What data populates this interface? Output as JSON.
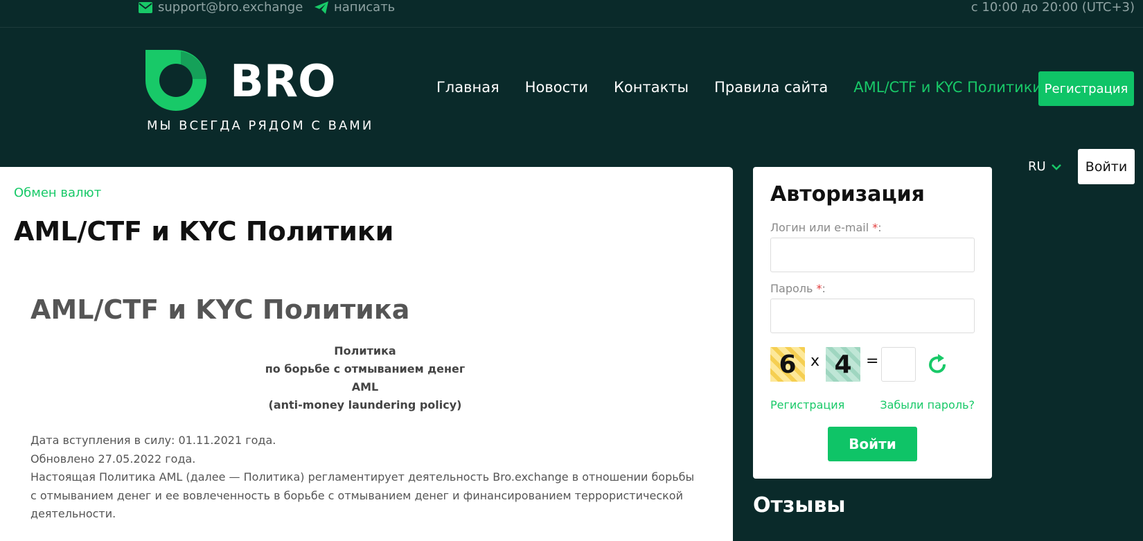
{
  "topbar": {
    "email": "support@bro.exchange",
    "telegram": "написать",
    "hours": "с 10:00 до 20:00 (UTC+3)"
  },
  "logo": {
    "name": "BRO",
    "slogan": "МЫ ВСЕГДА РЯДОМ С ВАМИ"
  },
  "nav": [
    "Главная",
    "Новости",
    "Контакты",
    "Правила сайта",
    "AML/CTF и KYC Политики"
  ],
  "header": {
    "register": "Регистрация",
    "lang": "RU",
    "login": "Войти"
  },
  "content": {
    "breadcrumb": "Обмен валют",
    "title": "AML/CTF и KYC Политики",
    "subtitle": "AML/CTF и KYC Политика",
    "center_lines": [
      "Политика",
      "по борьбе с отмыванием денег",
      "AML",
      "(anti-money laundering policy)"
    ],
    "para": [
      "Дата вступления в силу: 01.11.2021 года.",
      "Обновлено 27.05.2022 года.",
      "Настоящая Политика AML (далее — Политика) регламентирует деятельность Bro.exchange в отношении борьбы с отмыванием денег и ее вовлеченность в борьбе с отмыванием денег и финансированием террористической деятельности."
    ]
  },
  "auth": {
    "title": "Авторизация",
    "login_label": "Логин или e-mail",
    "password_label": "Пароль",
    "required_mark": "*",
    "colon": ":",
    "captcha_a": "6",
    "captcha_op": "x",
    "captcha_b": "4",
    "captcha_eq": "=",
    "register_link": "Регистрация",
    "forgot_link": "Забыли пароль?",
    "submit": "Войти"
  },
  "reviews_title": "Отзывы",
  "colors": {
    "background": "#0a2a2a",
    "accent": "#0fc467"
  }
}
